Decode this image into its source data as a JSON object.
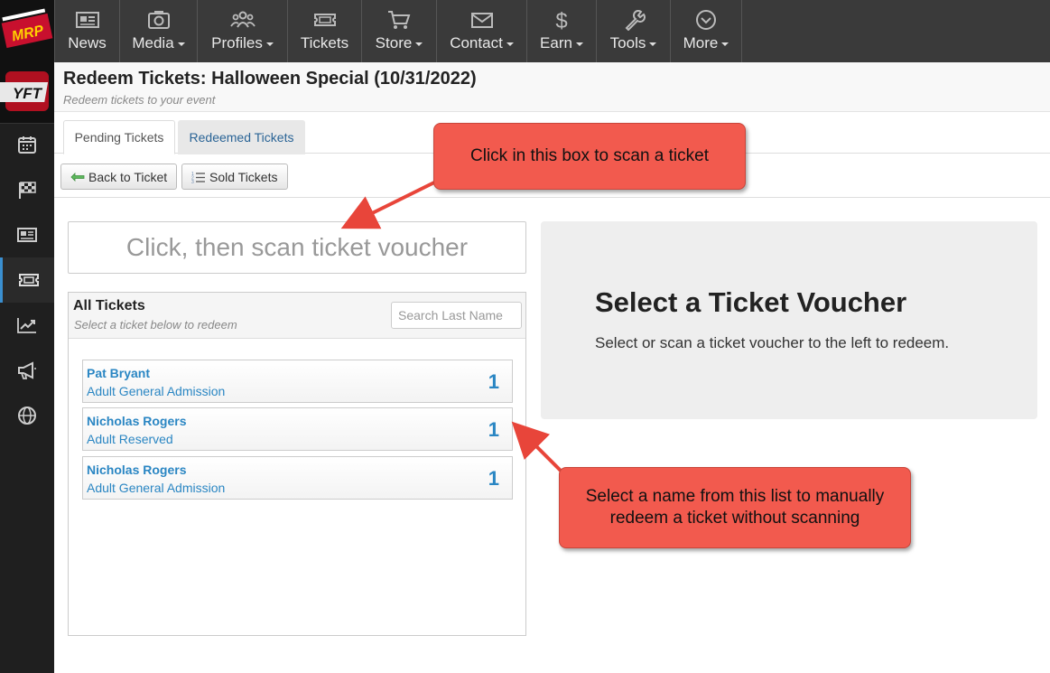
{
  "nav": {
    "items": [
      {
        "label": "News",
        "icon": "newspaper-icon",
        "dropdown": false
      },
      {
        "label": "Media",
        "icon": "camera-icon",
        "dropdown": true
      },
      {
        "label": "Profiles",
        "icon": "people-icon",
        "dropdown": true
      },
      {
        "label": "Tickets",
        "icon": "ticket-icon",
        "dropdown": false
      },
      {
        "label": "Store",
        "icon": "cart-icon",
        "dropdown": true
      },
      {
        "label": "Contact",
        "icon": "envelope-icon",
        "dropdown": true
      },
      {
        "label": "Earn",
        "icon": "dollar-icon",
        "dropdown": true
      },
      {
        "label": "Tools",
        "icon": "wrench-icon",
        "dropdown": true
      },
      {
        "label": "More",
        "icon": "chevron-circle-icon",
        "dropdown": true
      }
    ]
  },
  "brand": {
    "top_logo": "MRP",
    "side_logo": "YFT",
    "accent": "#3a8fd0"
  },
  "sidebar": {
    "items": [
      {
        "icon": "calendar-icon",
        "active": false
      },
      {
        "icon": "checkered-flag-icon",
        "active": false
      },
      {
        "icon": "news-icon",
        "active": false
      },
      {
        "icon": "ticket-icon",
        "active": true
      },
      {
        "icon": "chart-icon",
        "active": false
      },
      {
        "icon": "megaphone-icon",
        "active": false
      },
      {
        "icon": "globe-icon",
        "active": false
      }
    ]
  },
  "header": {
    "title": "Redeem Tickets: Halloween Special (10/31/2022)",
    "subtitle": "Redeem tickets to your event"
  },
  "tabs": {
    "pending": "Pending Tickets",
    "redeemed": "Redeemed Tickets"
  },
  "toolbar": {
    "back_label": "Back to Ticket",
    "sold_label": "Sold Tickets"
  },
  "scan": {
    "placeholder": "Click, then scan ticket voucher"
  },
  "tickets_panel": {
    "title": "All Tickets",
    "subtitle": "Select a ticket below to redeem",
    "search_placeholder": "Search Last Name",
    "items": [
      {
        "name": "Pat Bryant",
        "type": "Adult General Admission",
        "qty": "1"
      },
      {
        "name": "Nicholas Rogers",
        "type": "Adult Reserved",
        "qty": "1"
      },
      {
        "name": "Nicholas Rogers",
        "type": "Adult General Admission",
        "qty": "1"
      }
    ]
  },
  "voucher": {
    "title": "Select a Ticket Voucher",
    "text": "Select or scan a ticket voucher to the left to redeem."
  },
  "callouts": {
    "scan_hint": "Click in this box to scan a ticket",
    "list_hint_line1": "Select a name from this list to manually",
    "list_hint_line2": "redeem a ticket without scanning",
    "color": "#f25a4e"
  }
}
